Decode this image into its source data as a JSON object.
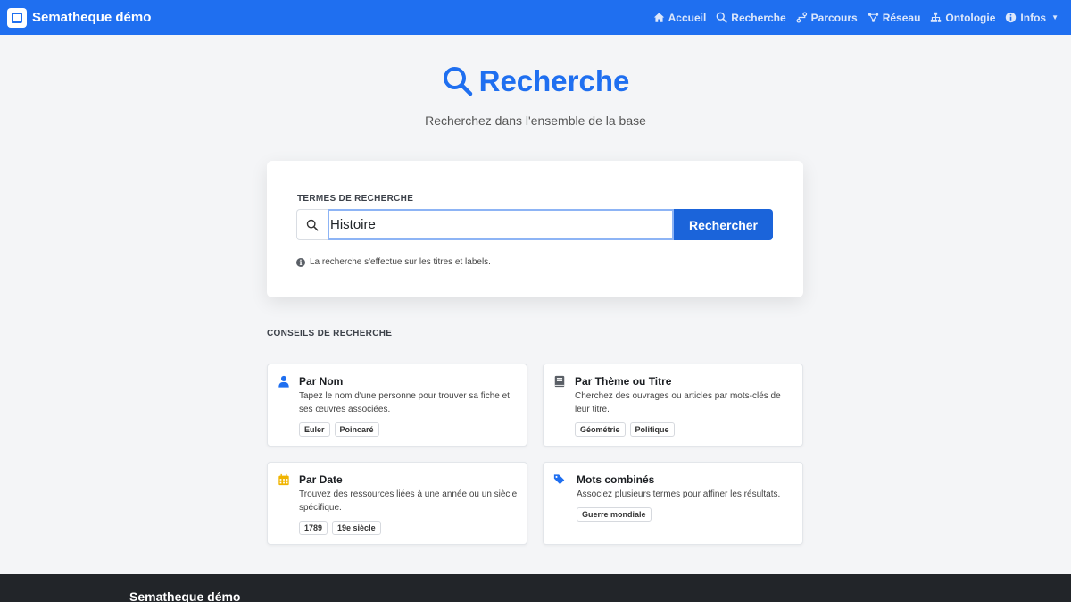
{
  "navbar": {
    "brand": "Sematheque démo",
    "links": [
      {
        "label": "Accueil",
        "icon": "home-icon"
      },
      {
        "label": "Recherche",
        "icon": "search-icon"
      },
      {
        "label": "Parcours",
        "icon": "route-icon"
      },
      {
        "label": "Réseau",
        "icon": "network-icon"
      },
      {
        "label": "Ontologie",
        "icon": "sitemap-icon"
      },
      {
        "label": "Infos",
        "icon": "info-icon"
      }
    ]
  },
  "hero": {
    "title": "Recherche",
    "subtitle": "Recherchez dans l'ensemble de la base"
  },
  "search": {
    "label": "TERMES DE RECHERCHE",
    "value": "Histoire",
    "button": "Rechercher",
    "hint": "La recherche s'effectue sur les titres et labels."
  },
  "tips": {
    "heading": "CONSEILS DE RECHERCHE",
    "cards": [
      {
        "title": "Par Nom",
        "icon": "user-icon",
        "desc": "Tapez le nom d'une personne pour trouver sa fiche et ses œuvres associées.",
        "tags": [
          "Euler",
          "Poincaré"
        ]
      },
      {
        "title": "Par Thème ou Titre",
        "icon": "book-icon",
        "desc": "Cherchez des ouvrages ou articles par mots-clés de leur titre.",
        "tags": [
          "Géométrie",
          "Politique"
        ]
      },
      {
        "title": "Par Date",
        "icon": "calendar-icon",
        "desc": "Trouvez des ressources liées à une année ou un siècle spécifique.",
        "tags": [
          "1789",
          "19e siècle"
        ]
      },
      {
        "title": "Mots combinés",
        "icon": "tags-icon",
        "desc": "Associez plusieurs termes pour affiner les résultats.",
        "tags": [
          "Guerre mondiale"
        ]
      }
    ]
  },
  "footer": {
    "brand": "Sematheque démo"
  },
  "colors": {
    "primary": "#1f6ff0",
    "button": "#1b64da",
    "footer": "#222529",
    "calendar": "#f0b400"
  }
}
